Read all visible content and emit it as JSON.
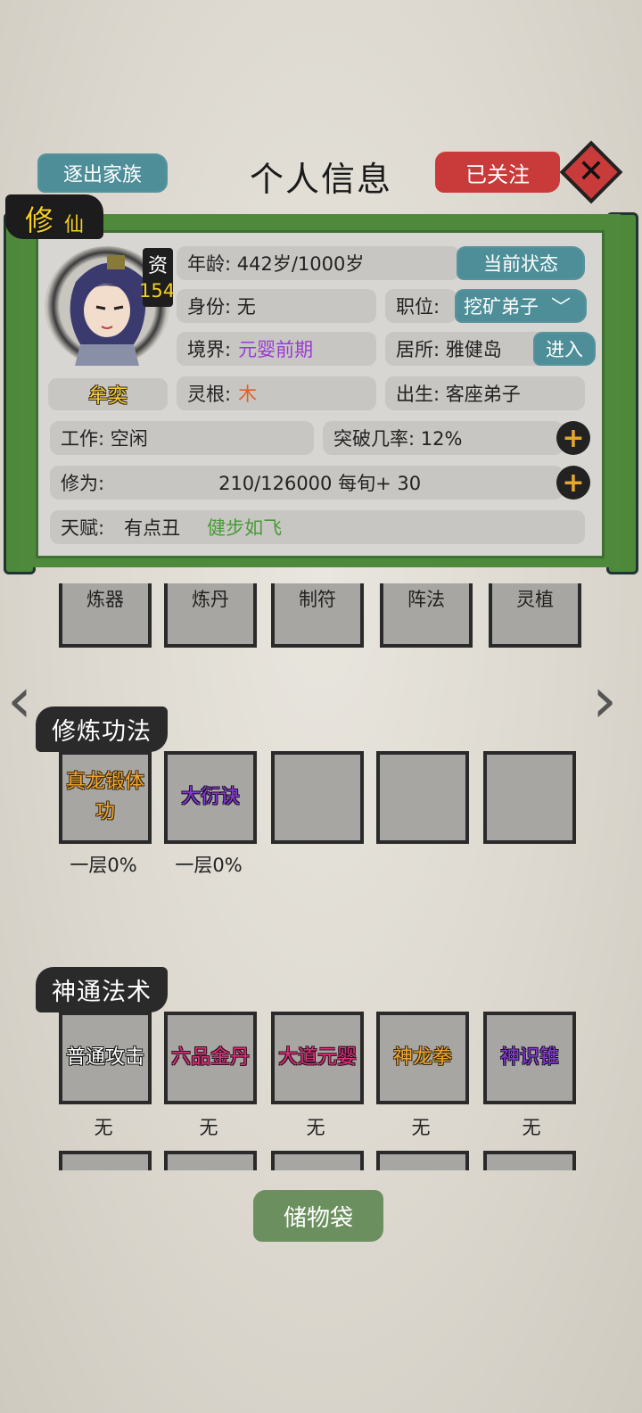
{
  "header": {
    "expel_label": "逐出家族",
    "title": "个人信息",
    "follow_label": "已关注"
  },
  "badge": {
    "main": "修",
    "sub": "仙"
  },
  "profile": {
    "aptitude_label": "资",
    "aptitude_value": "154",
    "name": "牟奕"
  },
  "fields": {
    "age": "年龄:      442岁/1000岁",
    "status_btn": "当前状态",
    "identity": "身份: 无",
    "position_label": "职位:",
    "position_value": "挖矿弟子",
    "realm_label": "境界:",
    "realm_value": "元婴前期",
    "residence": "居所: 雅健岛",
    "enter_btn": "进入",
    "root_label": "灵根:",
    "root_value": "木",
    "birth": "出生: 客座弟子",
    "work": "工作: 空闲",
    "breakthrough": "突破几率: 12%",
    "cultivation_label": "修为:",
    "cultivation_value": "210/126000  每旬+ 30",
    "talent_label": "天赋:",
    "talent_1": "有点丑",
    "talent_2": "健步如飞"
  },
  "crafts": [
    "炼器",
    "炼丹",
    "制符",
    "阵法",
    "灵植"
  ],
  "techniques": {
    "title": "修炼功法",
    "slots": [
      {
        "name": "真龙锻体功",
        "level": "一层0%"
      },
      {
        "name": "大衍诀",
        "level": "一层0%"
      },
      {
        "name": "",
        "level": ""
      },
      {
        "name": "",
        "level": ""
      },
      {
        "name": "",
        "level": ""
      }
    ]
  },
  "skills": {
    "title": "神通法术",
    "slots": [
      {
        "name": "普通攻击",
        "level": "无"
      },
      {
        "name": "六品金丹",
        "level": "无"
      },
      {
        "name": "大道元婴",
        "level": "无"
      },
      {
        "name": "神龙拳",
        "level": "无"
      },
      {
        "name": "神识锥",
        "level": "无"
      }
    ]
  },
  "storage_label": "储物袋",
  "colors": {
    "teal": "#4e8e98",
    "red": "#c93a3a",
    "green": "#4c8a3a",
    "realm_purple": "#9a3ad6",
    "root_orange": "#e0602a",
    "talent_green": "#4a9a3a",
    "aptitude_yellow": "#f5d020"
  }
}
